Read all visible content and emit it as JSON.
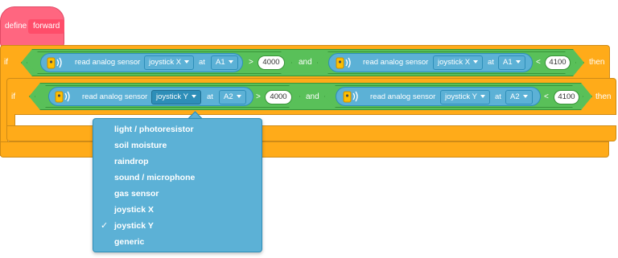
{
  "define_block": {
    "label": "define",
    "name": "forward"
  },
  "outer_if": {
    "if_label": "if",
    "then_label": "then",
    "and_label": "and",
    "left": {
      "text": "read analog sensor",
      "sensor": "joystick X",
      "at": "at",
      "pin": "A1",
      "op": ">",
      "value": "4000"
    },
    "right": {
      "text": "read analog sensor",
      "sensor": "joystick X",
      "at": "at",
      "pin": "A1",
      "op": "<",
      "value": "4100"
    }
  },
  "inner_if": {
    "if_label": "if",
    "then_label": "then",
    "and_label": "and",
    "left": {
      "text": "read analog sensor",
      "sensor": "joystick Y",
      "at": "at",
      "pin": "A2",
      "op": ">",
      "value": "4000"
    },
    "right": {
      "text": "read analog sensor",
      "sensor": "joystick Y",
      "at": "at",
      "pin": "A2",
      "op": "<",
      "value": "4100"
    }
  },
  "dropdown_menu": {
    "items": [
      "light / photoresistor",
      "soil moisture",
      "raindrop",
      "sound / microphone",
      "gas sensor",
      "joystick X",
      "joystick Y",
      "generic"
    ],
    "selected": "joystick Y",
    "check_mark": "✓"
  },
  "colors": {
    "define": "#ff6680",
    "control": "#ffab19",
    "operator": "#59c059",
    "sensor": "#5cb1d6"
  },
  "icons": {
    "sensor_icon": "sensor-radio-waves-icon"
  }
}
